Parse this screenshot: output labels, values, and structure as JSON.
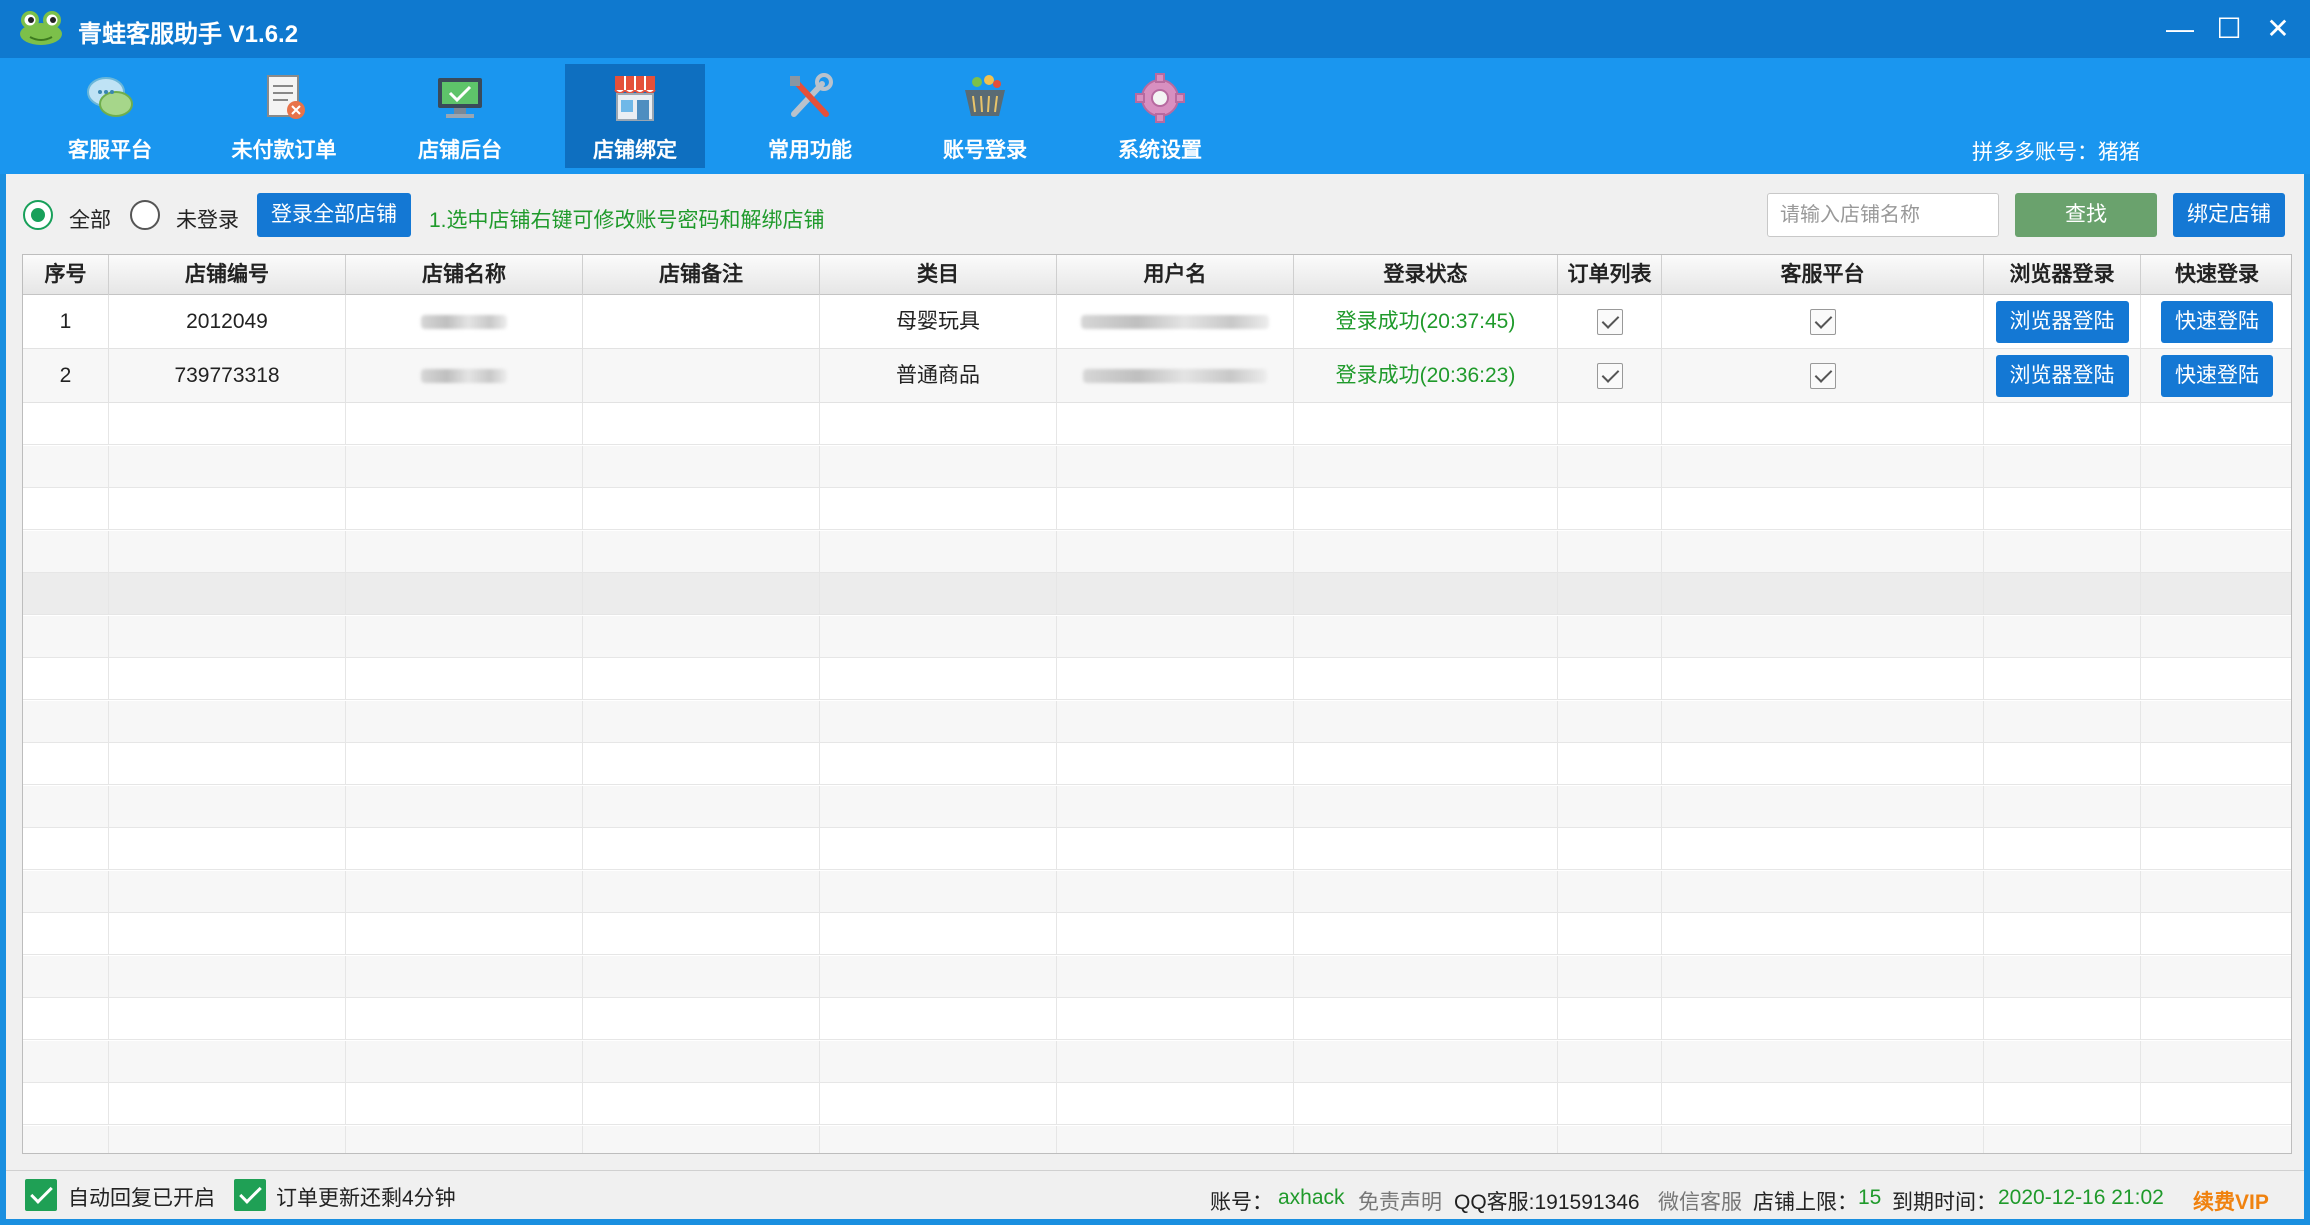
{
  "window": {
    "title": "青蛙客服助手 V1.6.2",
    "minimize": "—",
    "maximize": "☐",
    "close": "✕"
  },
  "toolbar": {
    "items": [
      {
        "label": "客服平台",
        "icon": "chat-bubbles-icon"
      },
      {
        "label": "未付款订单",
        "icon": "receipt-icon"
      },
      {
        "label": "店铺后台",
        "icon": "monitor-check-icon"
      },
      {
        "label": "店铺绑定",
        "icon": "storefront-icon",
        "active": true
      },
      {
        "label": "常用功能",
        "icon": "tools-icon"
      },
      {
        "label": "账号登录",
        "icon": "shopping-basket-icon"
      },
      {
        "label": "系统设置",
        "icon": "gear-icon"
      }
    ],
    "account_label": "拼多多账号：猪猪"
  },
  "filter": {
    "all_label": "全部",
    "not_logged_label": "未登录",
    "login_all_button": "登录全部店铺",
    "hint": "1.选中店铺右键可修改账号密码和解绑店铺",
    "search_placeholder": "请输入店铺名称",
    "search_button": "查找",
    "bind_button": "绑定店铺"
  },
  "table": {
    "headers": [
      "序号",
      "店铺编号",
      "店铺名称",
      "店铺备注",
      "类目",
      "用户名",
      "登录状态",
      "订单列表",
      "客服平台",
      "浏览器登录",
      "快速登录"
    ],
    "rows": [
      {
        "index": "1",
        "shop_id": "2012049",
        "category": "母婴玩具",
        "status": "登录成功(20:37:45)",
        "browser_btn": "浏览器登陆",
        "quick_btn": "快速登陆"
      },
      {
        "index": "2",
        "shop_id": "739773318",
        "category": "普通商品",
        "status": "登录成功(20:36:23)",
        "browser_btn": "浏览器登陆",
        "quick_btn": "快速登陆"
      }
    ]
  },
  "status": {
    "auto_reply": "自动回复已开启",
    "order_update": "订单更新还剩4分钟",
    "account_label": "账号：",
    "account_value": "axhack",
    "disclaimer": "免责声明",
    "qq": "QQ客服:191591346",
    "wechat": "微信客服",
    "shop_limit_label": "店铺上限：",
    "shop_limit_value": "15",
    "expire_label": "到期时间：",
    "expire_value": "2020-12-16 21:02",
    "renew": "续费VIP"
  },
  "colors": {
    "titlebar": "#0f79cf",
    "toolbar": "#1a96ef",
    "active_tab": "#0e6fc0",
    "button_blue": "#1478d4",
    "button_green": "#6aa26d",
    "success_green": "#1f9a2b",
    "renew_orange": "#f0820f"
  }
}
